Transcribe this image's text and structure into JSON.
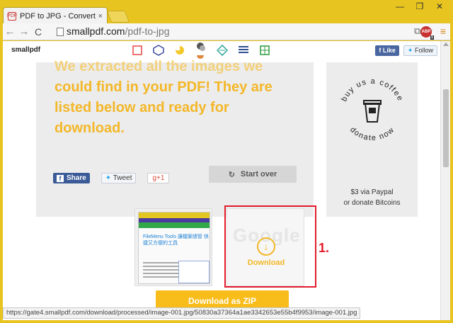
{
  "browser": {
    "tab_title": "PDF to JPG - Convert yo",
    "tab_close": "×",
    "window_controls": [
      "—",
      "❐",
      "✕"
    ],
    "back": "←",
    "forward": "→",
    "reload": "C",
    "url_host": "smallpdf.com",
    "url_path": "/pdf-to-jpg",
    "abp_label": "ABP",
    "abp_badge": "1",
    "menu": "≡"
  },
  "site": {
    "logo": "smallpdf",
    "fb_like": "f Like",
    "tw_follow": "Follow",
    "tool_icons": [
      "pdf-icon",
      "compress-icon",
      "merge-icon",
      "split-icon",
      "convert-icon",
      "text-icon",
      "grid-icon"
    ]
  },
  "main": {
    "headline_faded": "We extracted all the images we",
    "headline": "could find in your PDF! They are listed below and ready for download.",
    "share": "Share",
    "tweet": "Tweet",
    "gplus": "g+1",
    "start_over": "Start over"
  },
  "coffee": {
    "ring_top": "buy us a coffee",
    "ring_bottom": "donate now",
    "caption_line1": "$3 via Paypal",
    "caption_line2": "or donate Bitcoins"
  },
  "thumbnails": {
    "first_title": "FileMenu Tools 讓檔案總管 快捷又方便的工具",
    "second_label": "Download",
    "second_ghost": "Google"
  },
  "annotation": {
    "step": "1."
  },
  "download_zip": "Download as ZIP",
  "status_url": "https://gate4.smallpdf.com/download/processed/image-001.jpg/50830a37364a1ae3342653e55b4f9953/image-001.jpg",
  "colors": {
    "accent": "#f3b728",
    "frame": "#e7c41f",
    "highlight_red": "#e21b2b"
  }
}
